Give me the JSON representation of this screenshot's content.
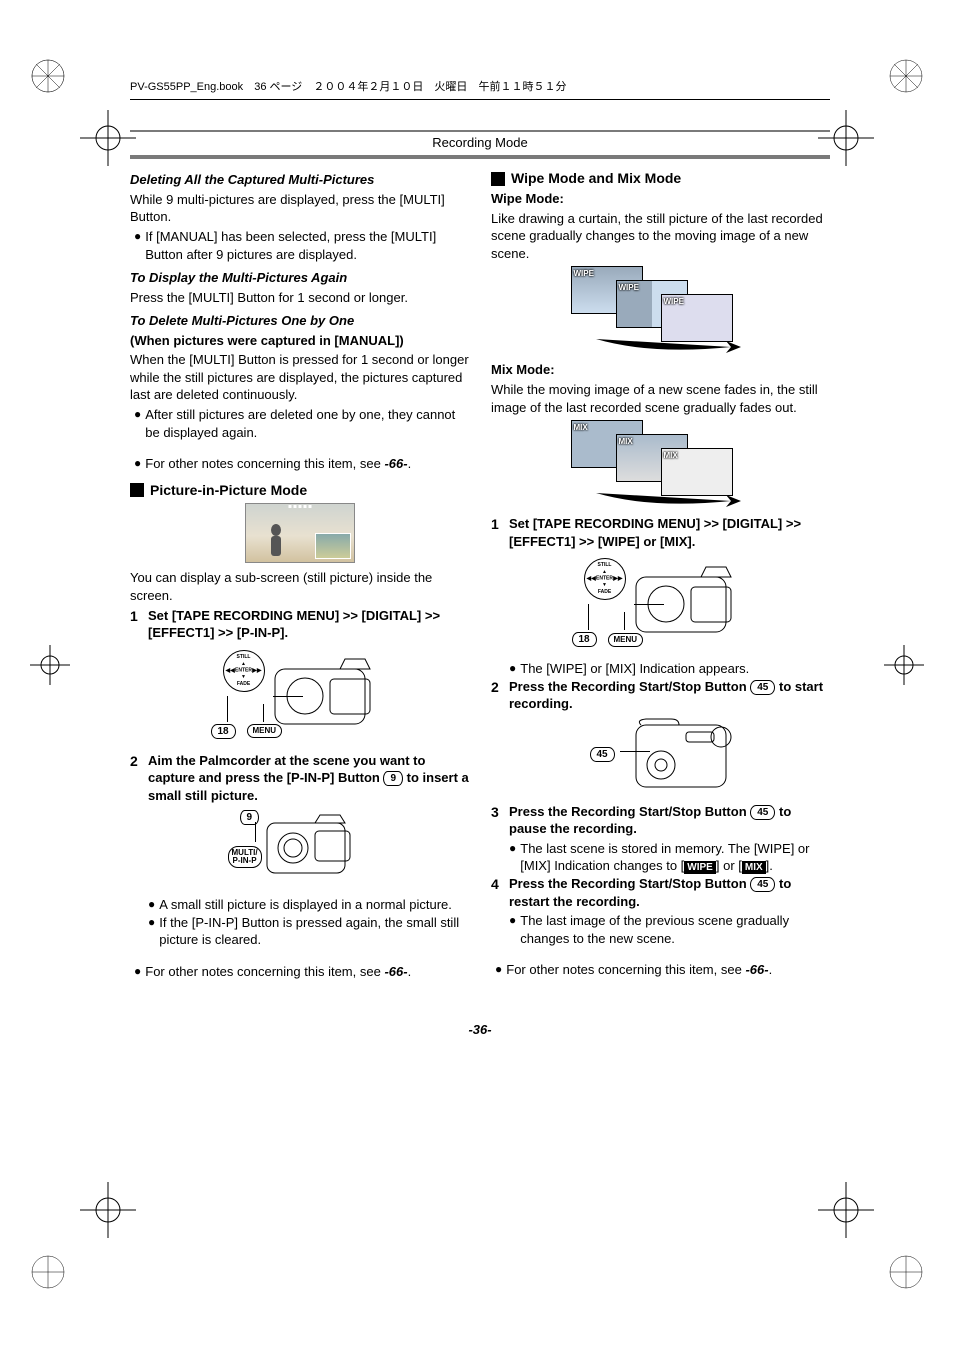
{
  "bookmark": {
    "file": "PV-GS55PP_Eng.book",
    "page_label": "36 ページ",
    "date": "２００４年２月１０日",
    "weekday": "火曜日",
    "time": "午前１１時５１分"
  },
  "section_header": "Recording Mode",
  "left": {
    "h_delete_all": "Deleting All the Captured Multi-Pictures",
    "delete_all_p": "While 9 multi-pictures are displayed, press the [MULTI] Button.",
    "delete_all_bullet": "If [MANUAL] has been selected, press the [MULTI] Button after 9 pictures are displayed.",
    "h_display_again": "To Display the Multi-Pictures Again",
    "display_again_p": "Press the [MULTI] Button for 1 second or longer.",
    "h_delete_one": "To Delete Multi-Pictures One by One",
    "h_delete_one_sub": "(When pictures were captured in [MANUAL])",
    "delete_one_p": "When the [MULTI] Button is pressed for 1 second or longer while the still pictures are displayed, the pictures captured last are deleted continuously.",
    "delete_one_bullet": "After still pictures are deleted one by one, they cannot be displayed again.",
    "other_notes_prefix": "For other notes concerning this item, see ",
    "other_notes_ref": "-66-",
    "pip_heading": "Picture-in-Picture Mode",
    "pip_intro": "You can display a sub-screen (still picture) inside the screen.",
    "pip_step1": "Set [TAPE RECORDING MENU] >> [DIGITAL] >> [EFFECT1] >> [P-IN-P].",
    "pip_step2_a": "Aim the Palmcorder at the scene you want to capture and press the [P-IN-P] Button ",
    "pip_step2_b": " to insert a small still picture.",
    "pip_bullet1": "A small still picture is displayed in a normal picture.",
    "pip_bullet2": "If the [P-IN-P] Button is pressed again, the small still picture is cleared.",
    "fig_ctrl": {
      "still": "STILL",
      "enter": "ENTER",
      "fade": "FADE",
      "ff": "",
      "rw": ""
    },
    "fig_label_18": "18",
    "fig_label_menu": "MENU",
    "fig_label_9": "9",
    "fig_label_multi": "MULTI/\nP-IN-P"
  },
  "right": {
    "heading": "Wipe Mode and Mix Mode",
    "wipe_h": "Wipe Mode:",
    "wipe_p": "Like drawing a curtain, the still picture of the last recorded scene gradually changes to the moving image of a new scene.",
    "wipe_label": "WIPE",
    "mix_h": "Mix Mode:",
    "mix_p": "While the moving image of a new scene fades in, the still image of the last recorded scene gradually fades out.",
    "mix_label": "MIX",
    "step1": "Set [TAPE RECORDING MENU] >> [DIGITAL] >> [EFFECT1] >> [WIPE] or [MIX].",
    "step1_bullet": "The [WIPE] or [MIX] Indication appears.",
    "step2_a": "Press the Recording Start/Stop Button ",
    "step2_b": " to start recording.",
    "label_45": "45",
    "step3_a": "Press the Recording Start/Stop Button ",
    "step3_b": " to pause the recording.",
    "step3_bullet_a": "The last scene is stored in memory. The [WIPE] or [MIX] Indication changes to [",
    "step3_bullet_b": "] or [",
    "step3_bullet_c": "].",
    "step4_a": "Press the Recording Start/Stop Button ",
    "step4_b": " to restart the recording.",
    "step4_bullet": "The last image of the previous scene gradually changes to the new scene.",
    "other_notes_prefix": "For other notes concerning this item, see ",
    "other_notes_ref": "-66-",
    "fig_label_18": "18",
    "fig_label_menu": "MENU"
  },
  "page_number": "-36-"
}
